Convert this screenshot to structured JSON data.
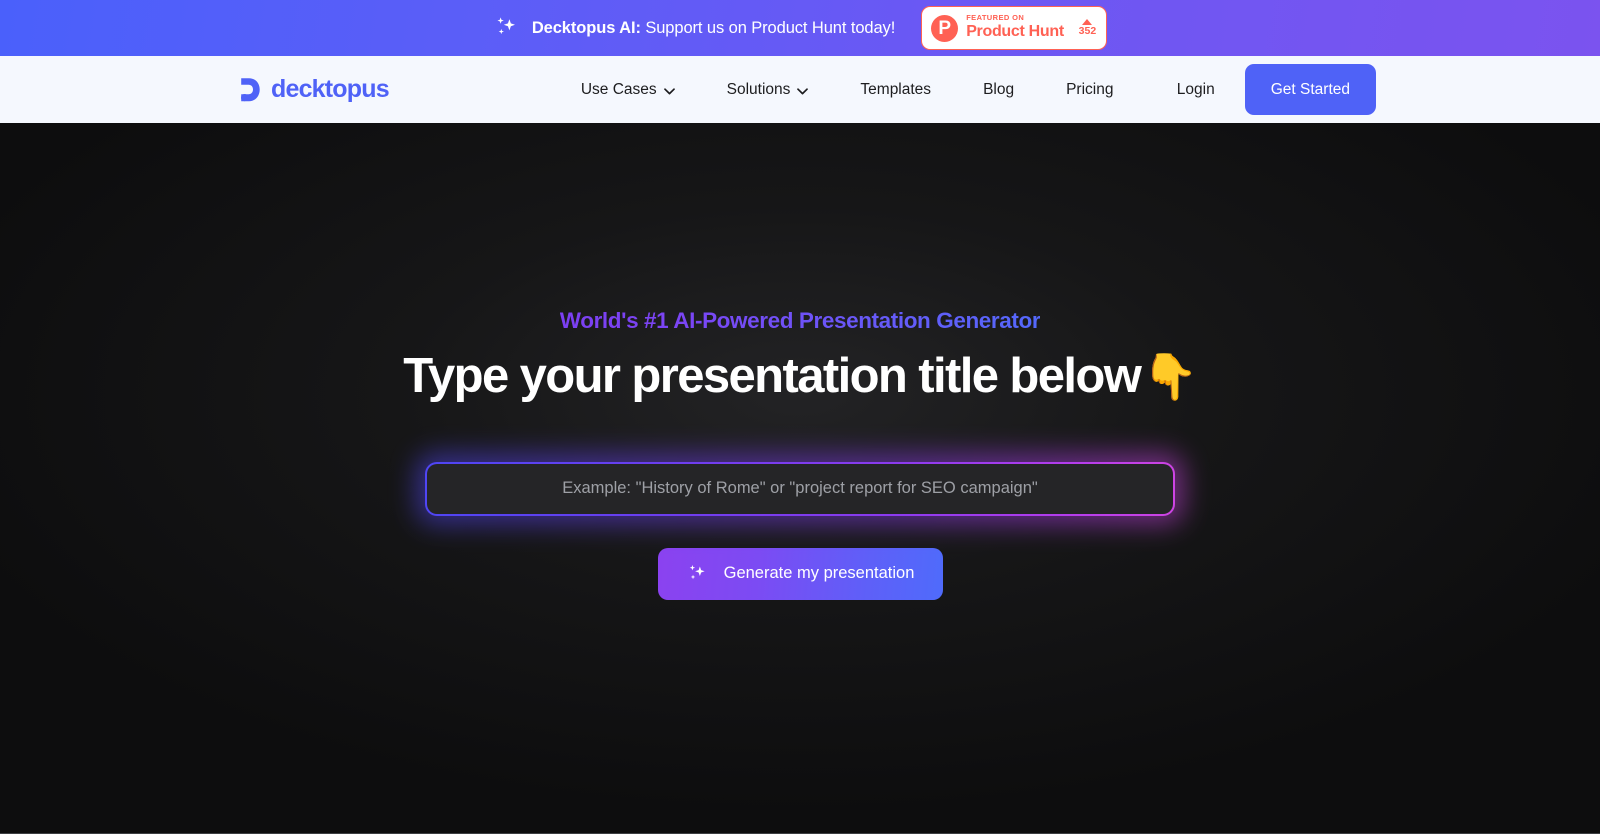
{
  "promo_banner": {
    "icon": "sparkles-icon",
    "title_bold": "Decktopus AI:",
    "title_rest": " Support us on Product Hunt today!",
    "badge": {
      "logo_letter": "P",
      "featured_label": "FEATURED ON",
      "product_name": "Product Hunt",
      "upvote_count": "352",
      "caret": "caret-up-icon"
    },
    "gradient_from": "#4a60fb",
    "gradient_to": "#7b53ef"
  },
  "navbar": {
    "logo": {
      "mark": "decktopus-d-icon",
      "word": "decktopus",
      "color": "#4f62f7"
    },
    "links": [
      {
        "label": "Use Cases",
        "has_dropdown": true
      },
      {
        "label": "Solutions",
        "has_dropdown": true
      },
      {
        "label": "Templates",
        "has_dropdown": false
      },
      {
        "label": "Blog",
        "has_dropdown": false
      },
      {
        "label": "Pricing",
        "has_dropdown": false
      }
    ],
    "login_label": "Login",
    "cta_label": "Get Started",
    "cta_color": "#4f62f7",
    "background": "#f5f8fe"
  },
  "hero": {
    "eyebrow": "World's #1 AI-Powered Presentation Generator",
    "eyebrow_gradient_from": "#7b3ff2",
    "eyebrow_gradient_to": "#5468fb",
    "headline": "Type your presentation title below",
    "headline_emoji": "👇",
    "input": {
      "value": "",
      "placeholder": "Example: \"History of Rome\" or \"project report for SEO campaign\"",
      "border_gradient_from": "#4f46f5",
      "border_gradient_to": "#cf45e3"
    },
    "generate_button": {
      "label": "Generate my presentation",
      "icon": "sparkles-icon",
      "gradient_from": "#8b42f0",
      "gradient_to": "#4f6bfb"
    },
    "background": "#101011"
  }
}
